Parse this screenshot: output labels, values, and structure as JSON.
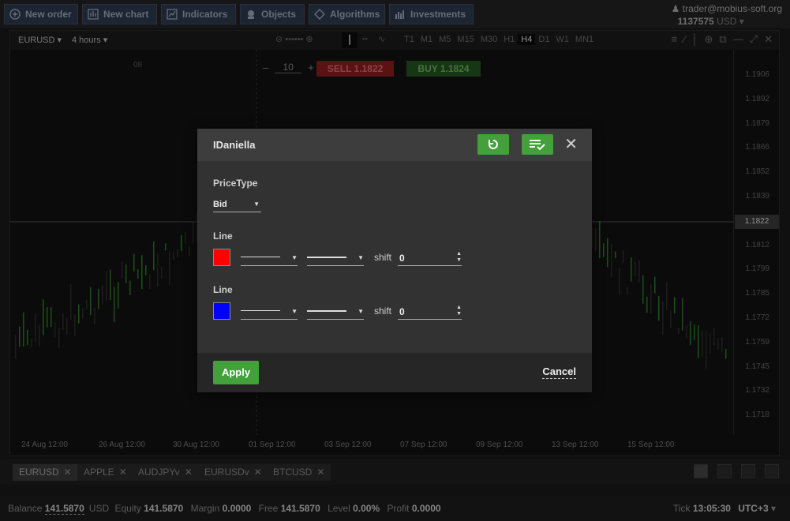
{
  "toolbar": {
    "buttons": [
      {
        "label": "New order",
        "icon": "plus-circle-icon"
      },
      {
        "label": "New chart",
        "icon": "chart-icon"
      },
      {
        "label": "Indicators",
        "icon": "indicator-icon"
      },
      {
        "label": "Objects",
        "icon": "objects-icon"
      },
      {
        "label": "Algorithms",
        "icon": "diamond-icon"
      },
      {
        "label": "Investments",
        "icon": "bars-icon"
      }
    ]
  },
  "user": {
    "email": "trader@mobius-soft.org",
    "account": "1137575",
    "currency": "USD"
  },
  "chart": {
    "symbol": "EURUSD",
    "timeframe": "4 hours",
    "timeframes": [
      "T1",
      "M1",
      "M5",
      "M15",
      "M30",
      "H1",
      "H4",
      "D1",
      "W1",
      "MN1"
    ],
    "active_timeframe": "H4",
    "quantity": "10",
    "sell_label": "SELL 1.1822",
    "buy_label": "BUY 1.1824",
    "current_price": "1.1822",
    "date_marker": "08",
    "y_labels": [
      "1.1906",
      "1.1892",
      "1.1879",
      "1.1866",
      "1.1852",
      "1.1839",
      "1.1825",
      "1.1812",
      "1.1799",
      "1.1785",
      "1.1772",
      "1.1759",
      "1.1745",
      "1.1732",
      "1.1718"
    ],
    "x_labels": [
      "24 Aug 12:00",
      "26 Aug 12:00",
      "30 Aug 12:00",
      "01 Sep 12:00",
      "03 Sep 12:00",
      "07 Sep 12:00",
      "09 Sep 12:00",
      "13 Sep 12:00",
      "15 Sep 12:00"
    ]
  },
  "dialog": {
    "title": "IDaniella",
    "price_type_label": "PriceType",
    "price_type_value": "Bid",
    "lines": [
      {
        "label": "Line",
        "color": "#ff0000",
        "shift_label": "shift",
        "shift_value": "0"
      },
      {
        "label": "Line",
        "color": "#0000ff",
        "shift_label": "shift",
        "shift_value": "0"
      }
    ],
    "apply_label": "Apply",
    "cancel_label": "Cancel"
  },
  "symbol_tabs": [
    "EURUSD",
    "APPLE",
    "AUDJPYv",
    "EURUSDv",
    "BTCUSD"
  ],
  "status": {
    "balance_label": "Balance",
    "balance": "141.5870",
    "balance_currency": "USD",
    "equity_label": "Equity",
    "equity": "141.5870",
    "margin_label": "Margin",
    "margin": "0.0000",
    "free_label": "Free",
    "free": "141.5870",
    "level_label": "Level",
    "level": "0.00%",
    "profit_label": "Profit",
    "profit": "0.0000",
    "tick_label": "Tick",
    "tick": "13:05:30",
    "timezone": "UTC+3"
  }
}
